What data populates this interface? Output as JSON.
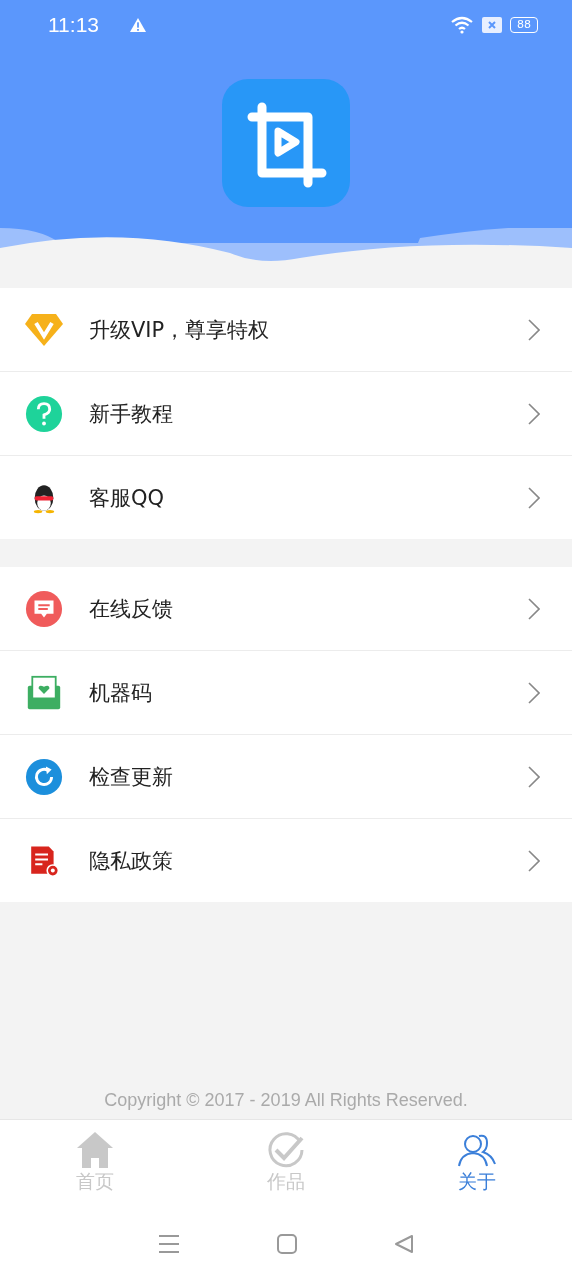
{
  "status_bar": {
    "time": "11:13",
    "battery": "88"
  },
  "menu_groups": [
    [
      {
        "kind": "vip",
        "label": "升级VIP，尊享特权"
      },
      {
        "kind": "help",
        "label": "新手教程"
      },
      {
        "kind": "qq",
        "label": "客服QQ"
      }
    ],
    [
      {
        "kind": "feedback",
        "label": "在线反馈"
      },
      {
        "kind": "machine",
        "label": "机器码"
      },
      {
        "kind": "update",
        "label": "检查更新"
      },
      {
        "kind": "privacy",
        "label": "隐私政策"
      }
    ]
  ],
  "copyright": "Copyright © 2017 - 2019 All Rights Reserved.",
  "tabs": [
    {
      "kind": "home",
      "label": "首页",
      "selected": false
    },
    {
      "kind": "works",
      "label": "作品",
      "selected": false
    },
    {
      "kind": "about",
      "label": "关于",
      "selected": true
    }
  ]
}
